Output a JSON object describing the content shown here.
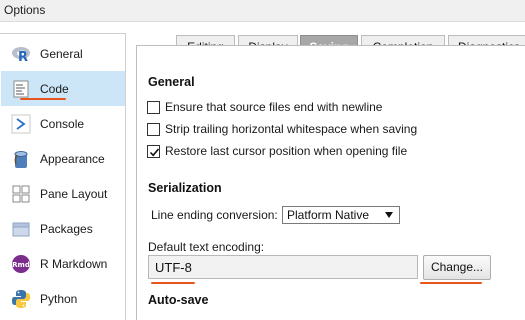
{
  "window": {
    "title": "Options"
  },
  "sidebar": {
    "items": [
      {
        "label": "General",
        "icon": "r-logo-icon"
      },
      {
        "label": "Code",
        "icon": "code-document-icon",
        "selected": true
      },
      {
        "label": "Console",
        "icon": "console-prompt-icon"
      },
      {
        "label": "Appearance",
        "icon": "paint-bucket-icon"
      },
      {
        "label": "Pane Layout",
        "icon": "pane-layout-icon"
      },
      {
        "label": "Packages",
        "icon": "packages-icon"
      },
      {
        "label": "R Markdown",
        "icon": "rmarkdown-icon",
        "icon_text": "Rmd"
      },
      {
        "label": "Python",
        "icon": "python-logo-icon"
      }
    ]
  },
  "tabs": [
    {
      "label": "Editing"
    },
    {
      "label": "Display"
    },
    {
      "label": "Saving",
      "active": true
    },
    {
      "label": "Completion"
    },
    {
      "label": "Diagnostics"
    }
  ],
  "general": {
    "title": "General",
    "options": [
      {
        "label": "Ensure that source files end with newline",
        "checked": false
      },
      {
        "label": "Strip trailing horizontal whitespace when saving",
        "checked": false
      },
      {
        "label": "Restore last cursor position when opening file",
        "checked": true
      }
    ]
  },
  "serialization": {
    "title": "Serialization",
    "line_ending_label": "Line ending conversion:",
    "line_ending_value": "Platform Native",
    "encoding_label": "Default text encoding:",
    "encoding_value": "UTF-8",
    "change_button": "Change..."
  },
  "autosave": {
    "title": "Auto-save"
  },
  "colors": {
    "selection": "#cde6f7",
    "active_tab": "#a7a7a7",
    "highlight_underline": "#e8541e"
  }
}
